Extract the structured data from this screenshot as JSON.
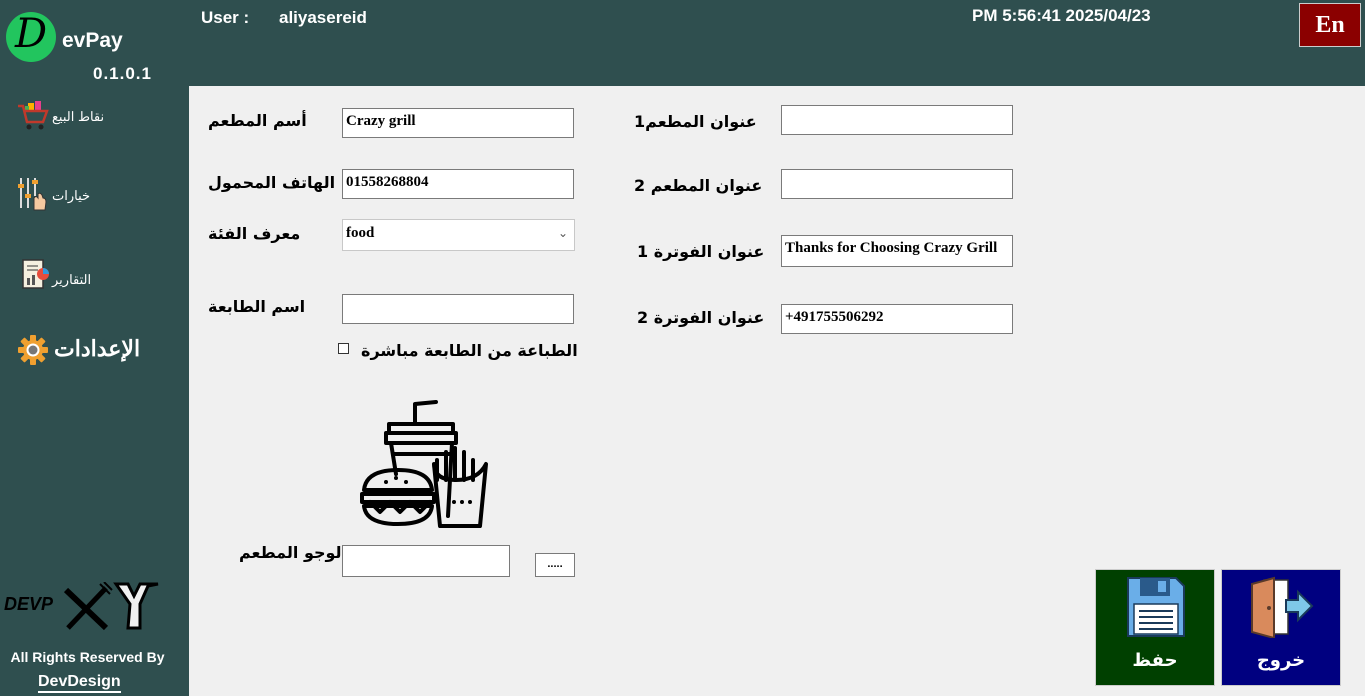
{
  "brand": {
    "initial": "D",
    "name": "evPay",
    "version": "0.1.0.1"
  },
  "header": {
    "user_label": "User :",
    "user_name": "aliyasereid",
    "datetime": "PM 5:56:41 2025/04/23",
    "lang_button": "En"
  },
  "sidebar": {
    "items": [
      {
        "label": "نقاط البيع",
        "icon": "shopping-cart-icon"
      },
      {
        "label": "خيارات",
        "icon": "options-sliders-icon"
      },
      {
        "label": "التقارير",
        "icon": "reports-icon"
      },
      {
        "label": "الإعدادات",
        "icon": "gear-icon"
      }
    ],
    "footer_logo_text": "DEVP",
    "rights": "All Rights Reserved By",
    "company": "DevDesign"
  },
  "form": {
    "restaurant_name": {
      "label": "أسم المطعم",
      "value": "Crazy grill"
    },
    "mobile": {
      "label": "الهاتف المحمول",
      "value": "01558268804"
    },
    "category": {
      "label": "معرف الفئة",
      "value": "food"
    },
    "printer": {
      "label": "اسم الطابعة",
      "value": ""
    },
    "direct_print": {
      "label": "الطباعة من الطابعة مباشرة",
      "checked": false
    },
    "address1": {
      "label": "عنوان المطعم1",
      "value": ""
    },
    "address2": {
      "label": "عنوان المطعم 2",
      "value": ""
    },
    "invoice_title1": {
      "label": "عنوان  الفوترة 1",
      "value": "Thanks for Choosing Crazy Grill"
    },
    "invoice_title2": {
      "label": "عنوان  الفوترة 2",
      "value": "+491755506292"
    },
    "logo": {
      "label": "لوجو المطعم",
      "value": "",
      "browse": "....."
    }
  },
  "actions": {
    "save": {
      "label": "حفظ",
      "color": "#004000"
    },
    "exit": {
      "label": "خروج",
      "color": "#000080"
    }
  },
  "colors": {
    "header_bg": "#2f4f4f",
    "lang_bg": "#8b0000",
    "accent": "#22c55e"
  }
}
